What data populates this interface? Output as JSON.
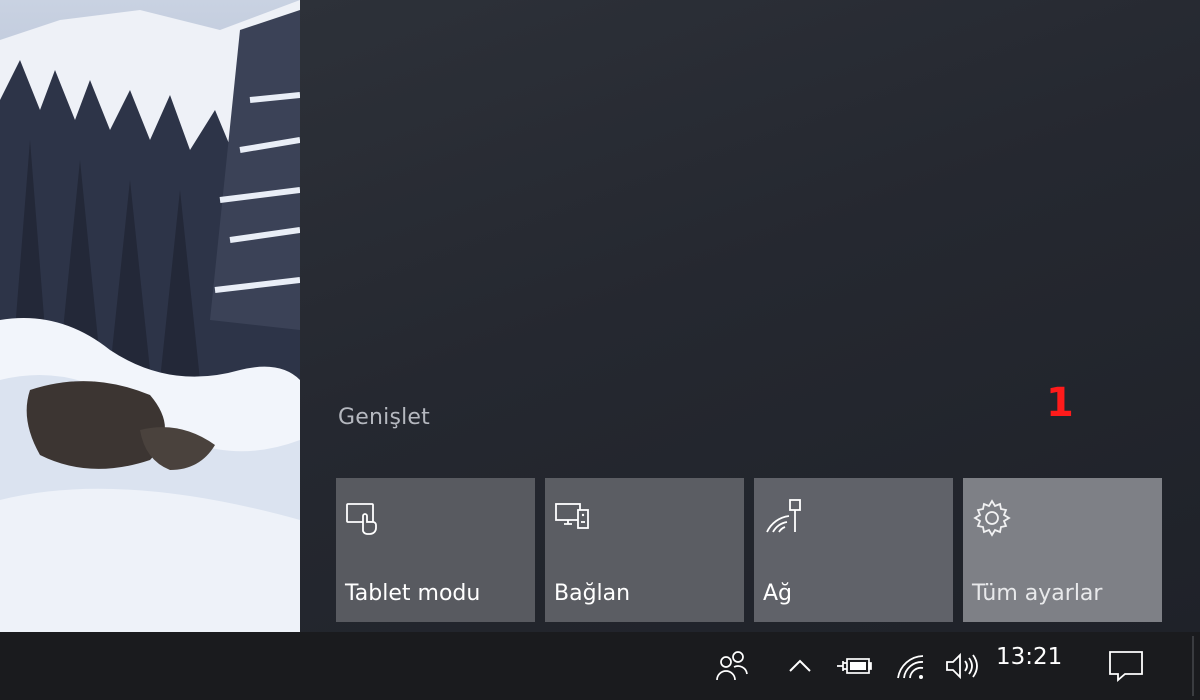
{
  "action_center": {
    "expand_label": "Genişlet",
    "annotation_number": "1",
    "quick_actions": [
      {
        "label": "Tablet modu",
        "icon": "tablet-mode-icon"
      },
      {
        "label": "Bağlan",
        "icon": "connect-icon"
      },
      {
        "label": "Ağ",
        "icon": "network-icon"
      },
      {
        "label": "Tüm ayarlar",
        "icon": "settings-gear-icon"
      }
    ]
  },
  "taskbar": {
    "clock": "13:21",
    "tray_icons": [
      "people-icon",
      "chevron-up-icon",
      "battery-charging-icon",
      "wifi-icon",
      "volume-icon",
      "notification-icon"
    ]
  },
  "colors": {
    "panel_bg": "#272a31",
    "tile_bg": "#585a60",
    "tile_active_bg": "#7e8086",
    "annotation": "#ff1b1b",
    "taskbar_bg": "#1a1b1e"
  }
}
